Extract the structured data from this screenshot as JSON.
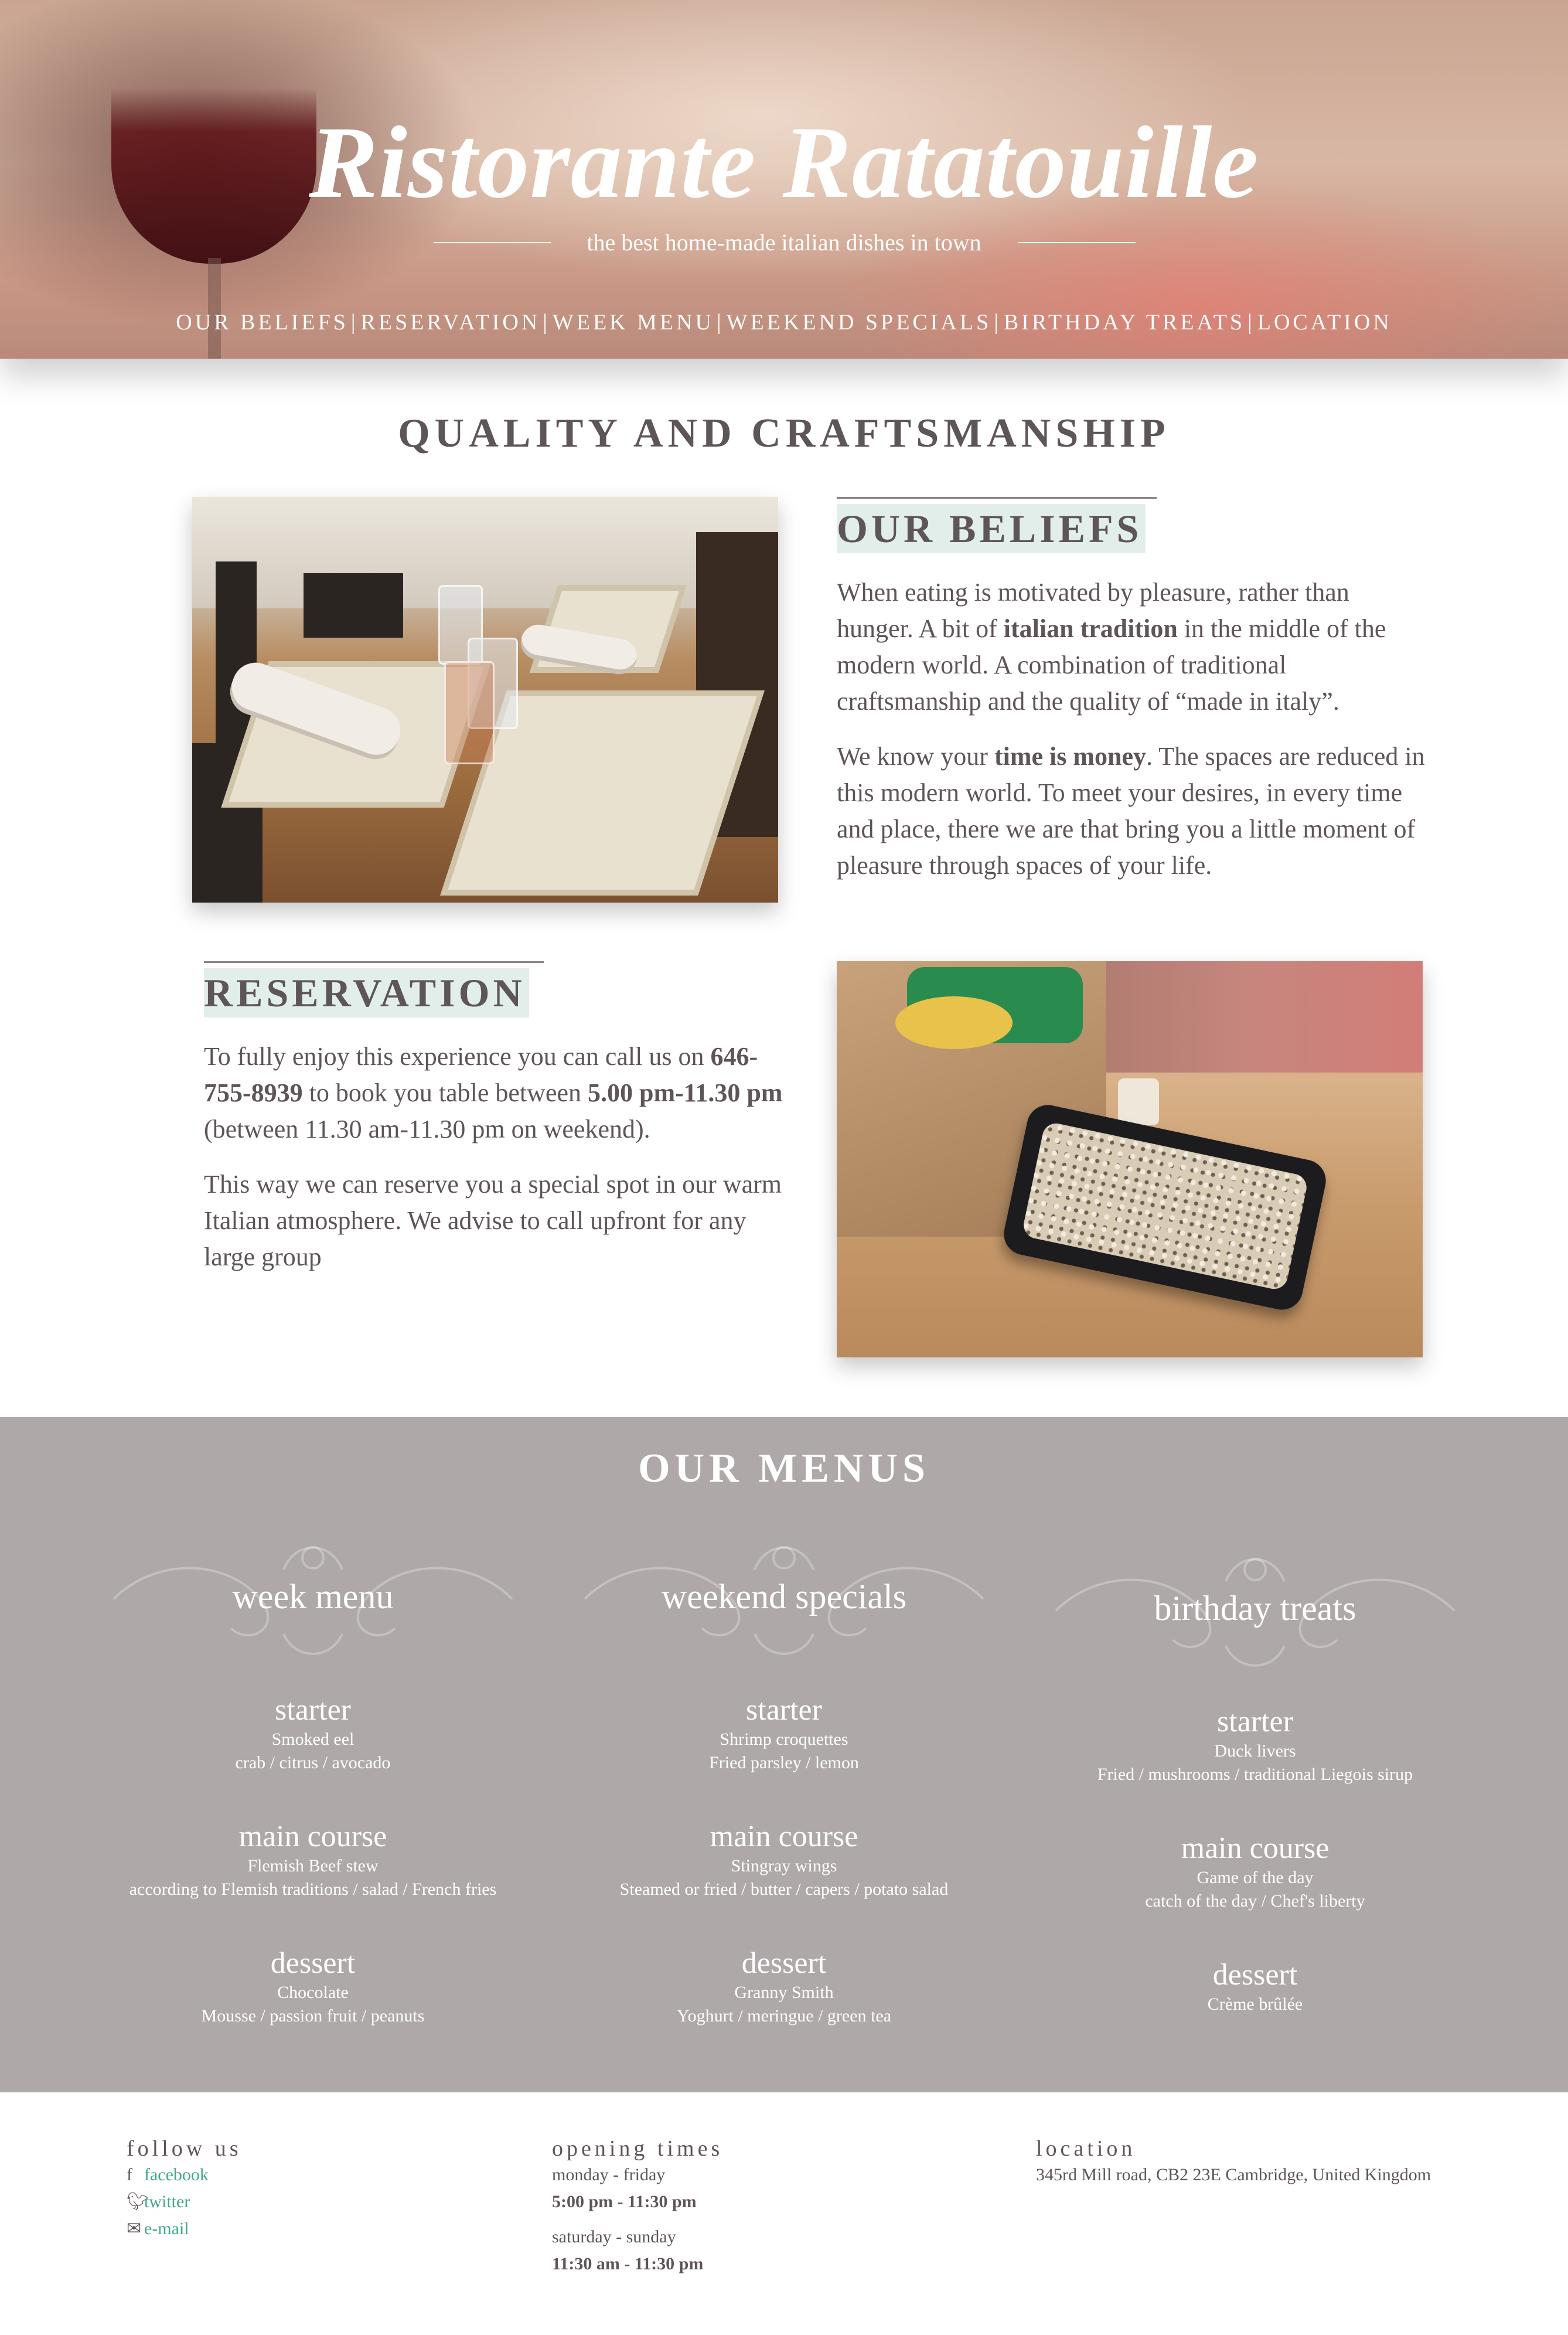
{
  "hero": {
    "title": "Ristorante Ratatouille",
    "subtitle": "the best home-made italian dishes in town"
  },
  "nav": {
    "items": [
      {
        "label": "OUR BELIEFS"
      },
      {
        "label": "RESERVATION"
      },
      {
        "label": "WEEK MENU"
      },
      {
        "label": "WEEKEND SPECIALS"
      },
      {
        "label": "BIRTHDAY TREATS"
      },
      {
        "label": "LOCATION"
      }
    ],
    "separator": "|"
  },
  "quality": {
    "heading": "QUALITY AND CRAFTSMANSHIP"
  },
  "beliefs": {
    "heading": "OUR BELIEFS",
    "p1_a": "When eating is motivated by pleasure, rather than hunger. A bit of ",
    "p1_b": "italian tradition",
    "p1_c": " in the middle of the modern world. A combination of traditional craftsmanship and the quality of “made in italy”.",
    "p2_a": "We know your ",
    "p2_b": "time is money",
    "p2_c": ". The spaces are reduced in this modern world. To meet your desires, in every time and place, there we are that bring you a little moment of pleasure through spaces of your life."
  },
  "reservation": {
    "heading": "RESERVATION",
    "p1_a": "To fully enjoy this experience you can call us on ",
    "p1_b": "646-755-8939",
    "p1_c": " to book you table between ",
    "p1_d": "5.00 pm-11.30 pm",
    "p1_e": " (between 11.30 am-11.30 pm on weekend).",
    "p2": "This way we can reserve you a special spot in our warm Italian atmosphere. We advise to call upfront for any large group"
  },
  "menus": {
    "heading": "OUR MENUS",
    "columns": [
      {
        "name": "week menu",
        "courses": [
          {
            "title": "starter",
            "line1": "Smoked eel",
            "line2": "crab / citrus / avocado"
          },
          {
            "title": "main course",
            "line1": "Flemish Beef stew",
            "line2": "according to Flemish traditions / salad / French fries"
          },
          {
            "title": "dessert",
            "line1": "Chocolate",
            "line2": "Mousse / passion fruit / peanuts"
          }
        ]
      },
      {
        "name": "weekend specials",
        "courses": [
          {
            "title": "starter",
            "line1": "Shrimp croquettes",
            "line2": "Fried parsley / lemon"
          },
          {
            "title": "main course",
            "line1": "Stingray wings",
            "line2": "Steamed or fried / butter / capers / potato salad"
          },
          {
            "title": "dessert",
            "line1": "Granny Smith",
            "line2": "Yoghurt / meringue / green tea"
          }
        ]
      },
      {
        "name": "birthday treats",
        "courses": [
          {
            "title": "starter",
            "line1": "Duck livers",
            "line2": "Fried / mushrooms / traditional Liegois sirup"
          },
          {
            "title": "main course",
            "line1": "Game of the day",
            "line2": "catch of the day / Chef's liberty"
          },
          {
            "title": "dessert",
            "line1": "Crème brûlée",
            "line2": ""
          }
        ]
      }
    ]
  },
  "footer": {
    "follow": {
      "heading": "follow us",
      "links": [
        {
          "icon": "facebook-icon",
          "label": "facebook"
        },
        {
          "icon": "twitter-icon",
          "label": "twitter"
        },
        {
          "icon": "email-icon",
          "label": "e-mail"
        }
      ]
    },
    "opening": {
      "heading": "opening times",
      "weekday_label": "monday - friday",
      "weekday_hours": "5:00 pm - 11:30 pm",
      "weekend_label": "saturday - sunday",
      "weekend_hours": "11:30 am - 11:30 pm"
    },
    "location": {
      "heading": "location",
      "address": "345rd Mill road, CB2 23E Cambridge, United Kingdom"
    }
  },
  "colors": {
    "text": "#5e5557",
    "menu_bg": "#aea8a9",
    "heading_highlight": "#e2eee9",
    "link": "#3fa88a"
  }
}
